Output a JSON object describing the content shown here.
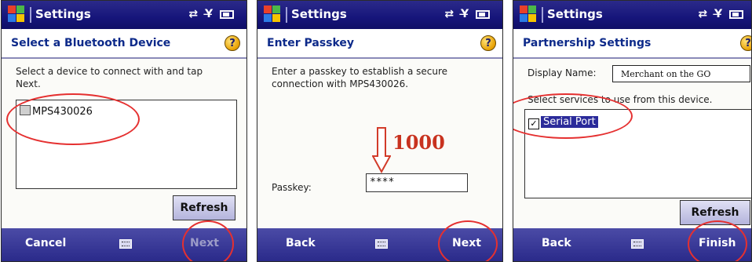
{
  "screens": [
    {
      "app_title": "Settings",
      "status_icons": "⇄ Y̶ ",
      "header_title": "Select a Bluetooth Device",
      "instruction": "Select a device to connect with and tap Next.",
      "device_name": "MPS430026",
      "refresh_label": "Refresh",
      "left_softkey": "Cancel",
      "right_softkey": "Next"
    },
    {
      "app_title": "Settings",
      "status_icons": "⇄ Y̶ ",
      "header_title": "Enter Passkey",
      "instruction": "Enter a passkey to establish a secure connection with MPS430026.",
      "annotation": "1000",
      "passkey_label": "Passkey:",
      "passkey_value": "****",
      "left_softkey": "Back",
      "right_softkey": "Next"
    },
    {
      "app_title": "Settings",
      "status_icons": "⇄ Y̶ ",
      "header_title": "Partnership Settings",
      "display_name_label": "Display Name:",
      "display_name_value": "Merchant on the GO",
      "services_label": "Select services to use from this device.",
      "service_item": "Serial Port",
      "refresh_label": "Refresh",
      "left_softkey": "Back",
      "right_softkey": "Finish"
    }
  ],
  "colors": {
    "titlebar": "#16157a",
    "softkey_bar": "#2a2a8a",
    "header_text": "#0d2a8a",
    "highlight_oval": "#e53030",
    "selection": "#2b2b9a"
  }
}
